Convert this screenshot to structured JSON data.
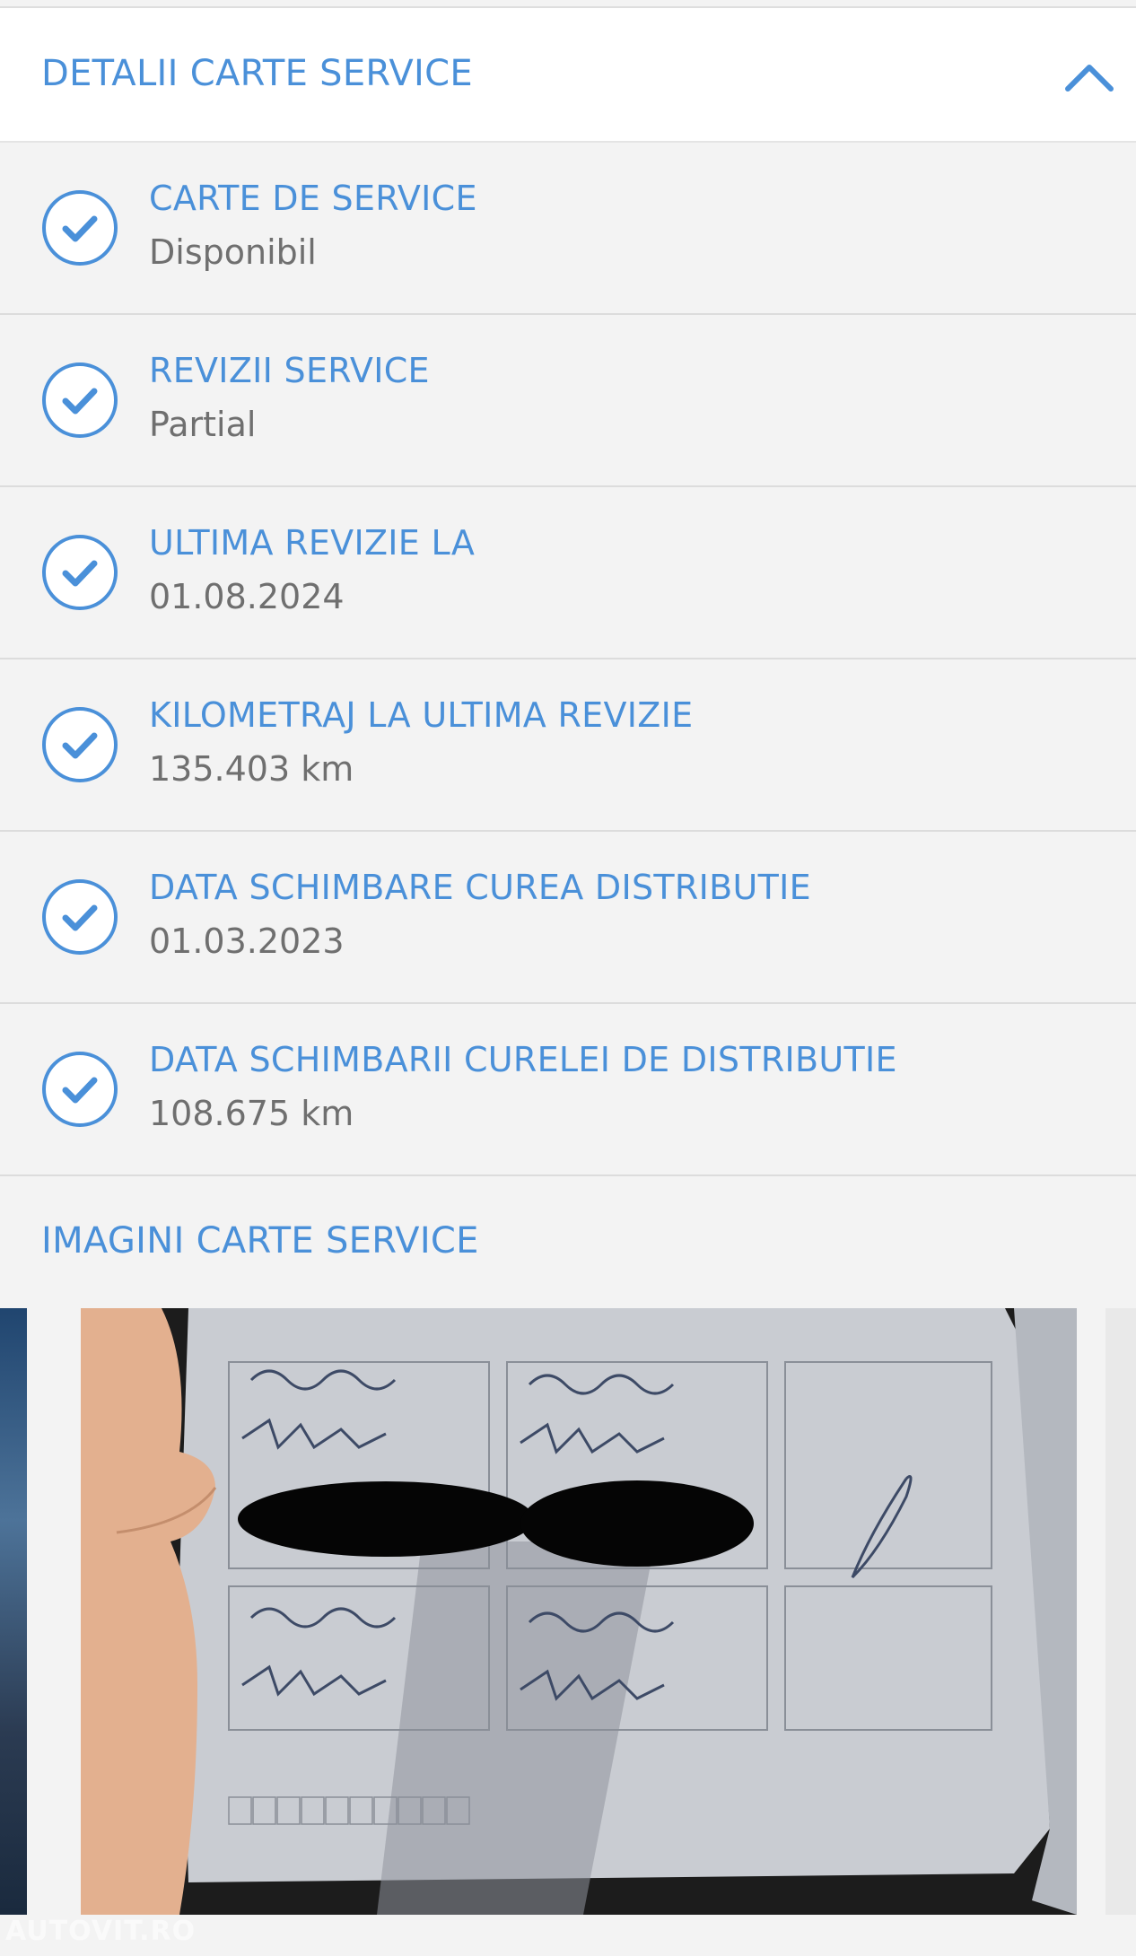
{
  "header": {
    "title": "DETALII CARTE SERVICE",
    "collapse_icon": "chevron-up-icon"
  },
  "details": [
    {
      "label": "CARTE DE SERVICE",
      "value": "Disponibil",
      "icon": "check-circle-icon"
    },
    {
      "label": "REVIZII SERVICE",
      "value": "Partial",
      "icon": "check-circle-icon"
    },
    {
      "label": "ULTIMA REVIZIE LA",
      "value": "01.08.2024",
      "icon": "check-circle-icon"
    },
    {
      "label": "KILOMETRAJ LA ULTIMA REVIZIE",
      "value": "135.403 km",
      "icon": "check-circle-icon"
    },
    {
      "label": "DATA SCHIMBARE CUREA DISTRIBUTIE",
      "value": "01.03.2023",
      "icon": "check-circle-icon"
    },
    {
      "label": "DATA SCHIMBARII CURELEI DE DISTRIBUTIE",
      "value": "108.675 km",
      "icon": "check-circle-icon"
    }
  ],
  "images_section": {
    "title": "IMAGINI CARTE SERVICE",
    "watermark": "AUTOVIT.RO"
  },
  "colors": {
    "accent": "#4a90d9",
    "value_text": "#6f6f6f",
    "background": "#f3f3f3",
    "header_background": "#ffffff"
  }
}
